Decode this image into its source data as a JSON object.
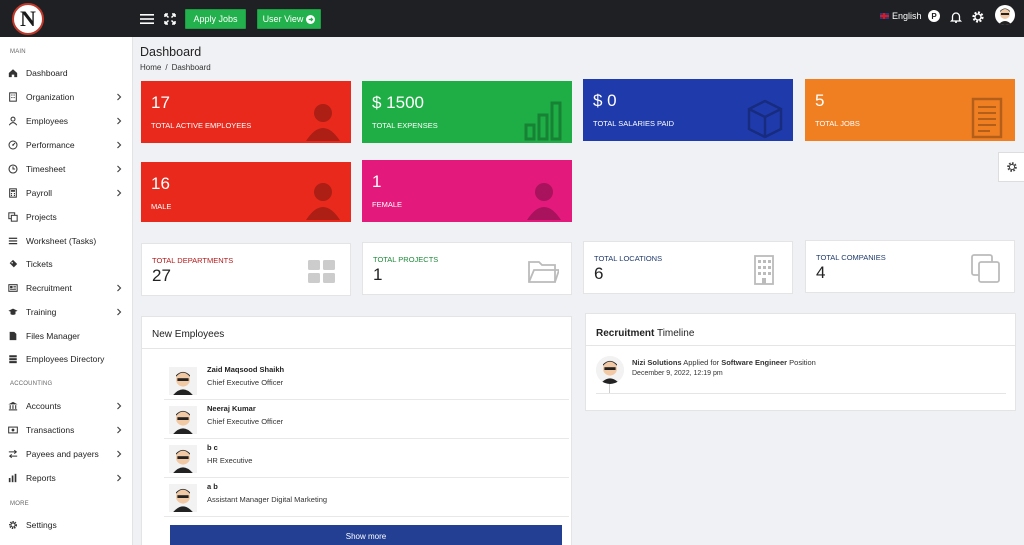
{
  "topbar": {
    "logo_letter": "N",
    "apply_jobs": "Apply Jobs",
    "user_view": "User View",
    "language": "English",
    "p_badge": "P"
  },
  "sidebar": {
    "sections": {
      "main": "MAIN",
      "accounting": "ACCOUNTING",
      "more": "MORE"
    },
    "items": [
      {
        "label": "Dashboard",
        "icon": "home-icon",
        "chevron": false
      },
      {
        "label": "Organization",
        "icon": "building-icon",
        "chevron": true
      },
      {
        "label": "Employees",
        "icon": "user-icon",
        "chevron": true
      },
      {
        "label": "Performance",
        "icon": "gauge-icon",
        "chevron": true
      },
      {
        "label": "Timesheet",
        "icon": "clock-icon",
        "chevron": true
      },
      {
        "label": "Payroll",
        "icon": "calculator-icon",
        "chevron": true
      },
      {
        "label": "Projects",
        "icon": "copy-icon",
        "chevron": false
      },
      {
        "label": "Worksheet (Tasks)",
        "icon": "list-icon",
        "chevron": false
      },
      {
        "label": "Tickets",
        "icon": "ticket-icon",
        "chevron": false
      },
      {
        "label": "Recruitment",
        "icon": "newspaper-icon",
        "chevron": true
      },
      {
        "label": "Training",
        "icon": "graduation-cap-icon",
        "chevron": true
      },
      {
        "label": "Files Manager",
        "icon": "file-icon",
        "chevron": false
      },
      {
        "label": "Employees Directory",
        "icon": "database-icon",
        "chevron": false
      },
      {
        "label": "Accounts",
        "icon": "bank-icon",
        "chevron": true
      },
      {
        "label": "Transactions",
        "icon": "money-icon",
        "chevron": true
      },
      {
        "label": "Payees and payers",
        "icon": "exchange-icon",
        "chevron": true
      },
      {
        "label": "Reports",
        "icon": "bar-chart-icon",
        "chevron": true
      },
      {
        "label": "Settings",
        "icon": "gear-icon",
        "chevron": false
      }
    ]
  },
  "page": {
    "title": "Dashboard",
    "breadcrumb_home": "Home",
    "breadcrumb_sep": "/",
    "breadcrumb_current": "Dashboard"
  },
  "stats": [
    {
      "value": "17",
      "label": "TOTAL ACTIVE EMPLOYEES",
      "color": "#e8291c",
      "icon": "user-icon"
    },
    {
      "value": "$ 1500",
      "label": "TOTAL EXPENSES",
      "color": "#1fae46",
      "icon": "bar-chart-icon"
    },
    {
      "value": "$ 0",
      "label": "TOTAL SALARIES PAID",
      "color": "#1f3aab",
      "icon": "box-icon"
    },
    {
      "value": "5",
      "label": "TOTAL JOBS",
      "color": "#f07f22",
      "icon": "document-icon"
    },
    {
      "value": "16",
      "label": "MALE",
      "color": "#e8291c",
      "icon": "user-icon"
    },
    {
      "value": "1",
      "label": "FEMALE",
      "color": "#e3197c",
      "icon": "user-icon"
    }
  ],
  "totals": [
    {
      "label": "TOTAL DEPARTMENTS",
      "value": "27",
      "color": "#b31b1b",
      "icon": "grid-icon"
    },
    {
      "label": "TOTAL PROJECTS",
      "value": "1",
      "color": "#1e8a3a",
      "icon": "folder-icon"
    },
    {
      "label": "TOTAL LOCATIONS",
      "value": "6",
      "color": "#1f3a6b",
      "icon": "building-icon"
    },
    {
      "label": "TOTAL COMPANIES",
      "value": "4",
      "color": "#1f3a6b",
      "icon": "copy-icon"
    }
  ],
  "new_employees": {
    "title": "New Employees",
    "rows": [
      {
        "name": "Zaid Maqsood Shaikh",
        "role": "Chief Executive Officer"
      },
      {
        "name": "Neeraj Kumar",
        "role": "Chief Executive Officer"
      },
      {
        "name": "b c",
        "role": "HR Executive"
      },
      {
        "name": "a b",
        "role": "Assistant Manager Digital Marketing"
      }
    ],
    "show_more": "Show more"
  },
  "recruitment": {
    "title_bold": "Recruitment",
    "title_rest": " Timeline",
    "company": "Nizi Solutions",
    "applied_for": " Applied for ",
    "position": "Software Engineer",
    "position_suffix": " Position",
    "date": "December 9, 2022, 12:19 pm"
  }
}
